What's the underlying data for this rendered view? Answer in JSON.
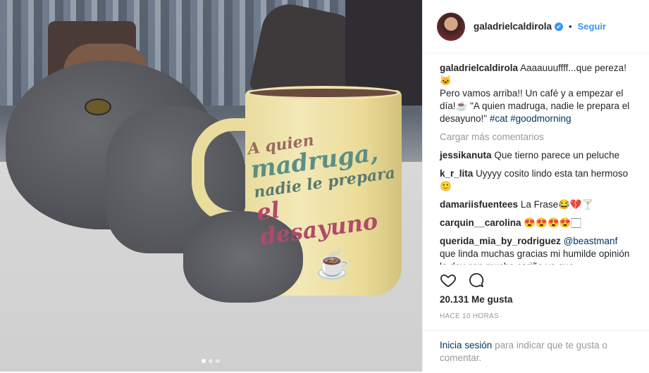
{
  "post": {
    "photo_alt": "",
    "mug_text": [
      "A quien",
      "madruga,",
      "nadie le prepara",
      "el desayuno"
    ],
    "carousel_dots": 3,
    "active_dot": 0
  },
  "author": {
    "username": "galadrielcaldirola",
    "verified_mark": "✔",
    "separator": "•",
    "follow_label": "Seguir"
  },
  "caption": {
    "username": "galadrielcaldirola",
    "text1": "Aaaauuuffff...que pereza! 🐱",
    "text2": "Pero vamos arriba!! Un café y a empezar el día!☕ \"A quien madruga, nadie le prepara el desayuno!\"",
    "hashtag1": "#cat",
    "hashtag2": "#goodmorning"
  },
  "load_more_label": "Cargar más comentarios",
  "comments": [
    {
      "user": "jessikanuta",
      "text": "Que tierno parece un peluche"
    },
    {
      "user": "k_r_lita",
      "text": "Uyyyy cosito lindo esta tan hermoso 🙂"
    },
    {
      "user": "damariisfuentees",
      "text": "La Frase😂💔🍸"
    },
    {
      "user": "carquin__carolina",
      "text": "😍😍😍😍🏻"
    },
    {
      "user": "querida_mia_by_rodriguez",
      "mention": "@beastmanf",
      "text": "que linda muchas gracias mi humilde opinión la doy con mucho cariño ya que"
    }
  ],
  "likes": "20.131 Me gusta",
  "timestamp": "HACE 10 HORAS",
  "login": {
    "link": "Inicia sesión",
    "rest": "para indicar que te gusta o comentar."
  },
  "icons": {
    "like": "heart-icon",
    "comment": "comment-bubble-icon",
    "verified": "verified-badge-icon"
  },
  "colors": {
    "accent": "#3897f0",
    "link": "#003569",
    "muted": "#999999"
  }
}
